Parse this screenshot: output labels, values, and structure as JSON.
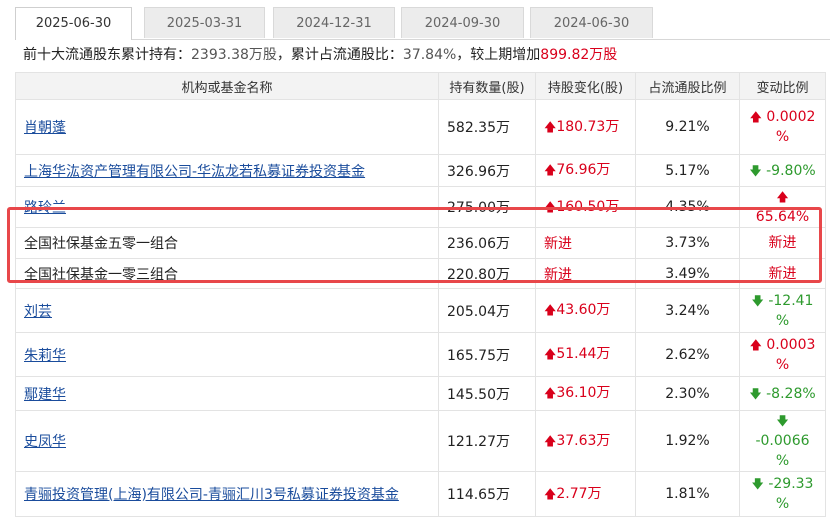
{
  "tabs": [
    "2025-06-30",
    "2025-03-31",
    "2024-12-31",
    "2024-09-30",
    "2024-06-30"
  ],
  "summary": {
    "prefix": "前十大流通股东累计持有：",
    "shares": "2393.38万股",
    "mid": "，累计占流通股比：",
    "ratio": "37.84%",
    "change_prefix": "，较上期增加",
    "change": "899.82万股"
  },
  "table": {
    "headers": [
      "机构或基金名称",
      "持有数量(股)",
      "持股变化(股)",
      "占流通股比例",
      "变动比例"
    ],
    "rows": [
      {
        "name": "肖朝蓬",
        "link": true,
        "qty": "582.35万",
        "chg_arrow": "up",
        "chg": "180.73万",
        "ratio": "9.21%",
        "pct_arrow": "up",
        "pct_line1": "0.0002",
        "pct_line2": "%"
      },
      {
        "name": "上海华汯资产管理有限公司-华汯龙若私募证券投资基金",
        "link": true,
        "qty": "326.96万",
        "chg_arrow": "up",
        "chg": "76.96万",
        "ratio": "5.17%",
        "pct_arrow": "down",
        "pct_line1": "-9.80%",
        "pct_line2": ""
      },
      {
        "name": "路玲兰",
        "link": true,
        "qty": "275.00万",
        "chg_arrow": "up",
        "chg": "160.50万",
        "ratio": "4.35%",
        "pct_arrow": "up",
        "pct_line1": "65.64%",
        "pct_line2": ""
      },
      {
        "name": "全国社保基金五零一组合",
        "link": false,
        "qty": "236.06万",
        "chg_arrow": "",
        "chg": "新进",
        "ratio": "3.73%",
        "pct_arrow": "",
        "pct_line1": "新进",
        "pct_line2": ""
      },
      {
        "name": "全国社保基金一零三组合",
        "link": false,
        "qty": "220.80万",
        "chg_arrow": "",
        "chg": "新进",
        "ratio": "3.49%",
        "pct_arrow": "",
        "pct_line1": "新进",
        "pct_line2": ""
      },
      {
        "name": "刘芸",
        "link": true,
        "qty": "205.04万",
        "chg_arrow": "up",
        "chg": "43.60万",
        "ratio": "3.24%",
        "pct_arrow": "down",
        "pct_line1": "-12.41",
        "pct_line2": "%"
      },
      {
        "name": "朱莉华",
        "link": true,
        "qty": "165.75万",
        "chg_arrow": "up",
        "chg": "51.44万",
        "ratio": "2.62%",
        "pct_arrow": "up",
        "pct_line1": "0.0003",
        "pct_line2": "%"
      },
      {
        "name": "鄢建华",
        "link": true,
        "qty": "145.50万",
        "chg_arrow": "up",
        "chg": "36.10万",
        "ratio": "2.30%",
        "pct_arrow": "down",
        "pct_line1": "-8.28%",
        "pct_line2": ""
      },
      {
        "name": "史凤华",
        "link": true,
        "qty": "121.27万",
        "chg_arrow": "up",
        "chg": "37.63万",
        "ratio": "1.92%",
        "pct_arrow": "down",
        "pct_line1": "-0.0066",
        "pct_line2": "%"
      },
      {
        "name": "青骊投资管理(上海)有限公司-青骊汇川3号私募证券投资基金",
        "link": true,
        "qty": "114.65万",
        "chg_arrow": "up",
        "chg": "2.77万",
        "ratio": "1.81%",
        "pct_arrow": "down",
        "pct_line1": "-29.33",
        "pct_line2": "%"
      }
    ]
  },
  "icons": {
    "up": "arrow-up-icon",
    "down": "arrow-down-icon"
  },
  "colors": {
    "up": "#d9001b",
    "down": "#2e9a2e",
    "link": "#1a4c9c",
    "highlight": "#e8474a"
  }
}
